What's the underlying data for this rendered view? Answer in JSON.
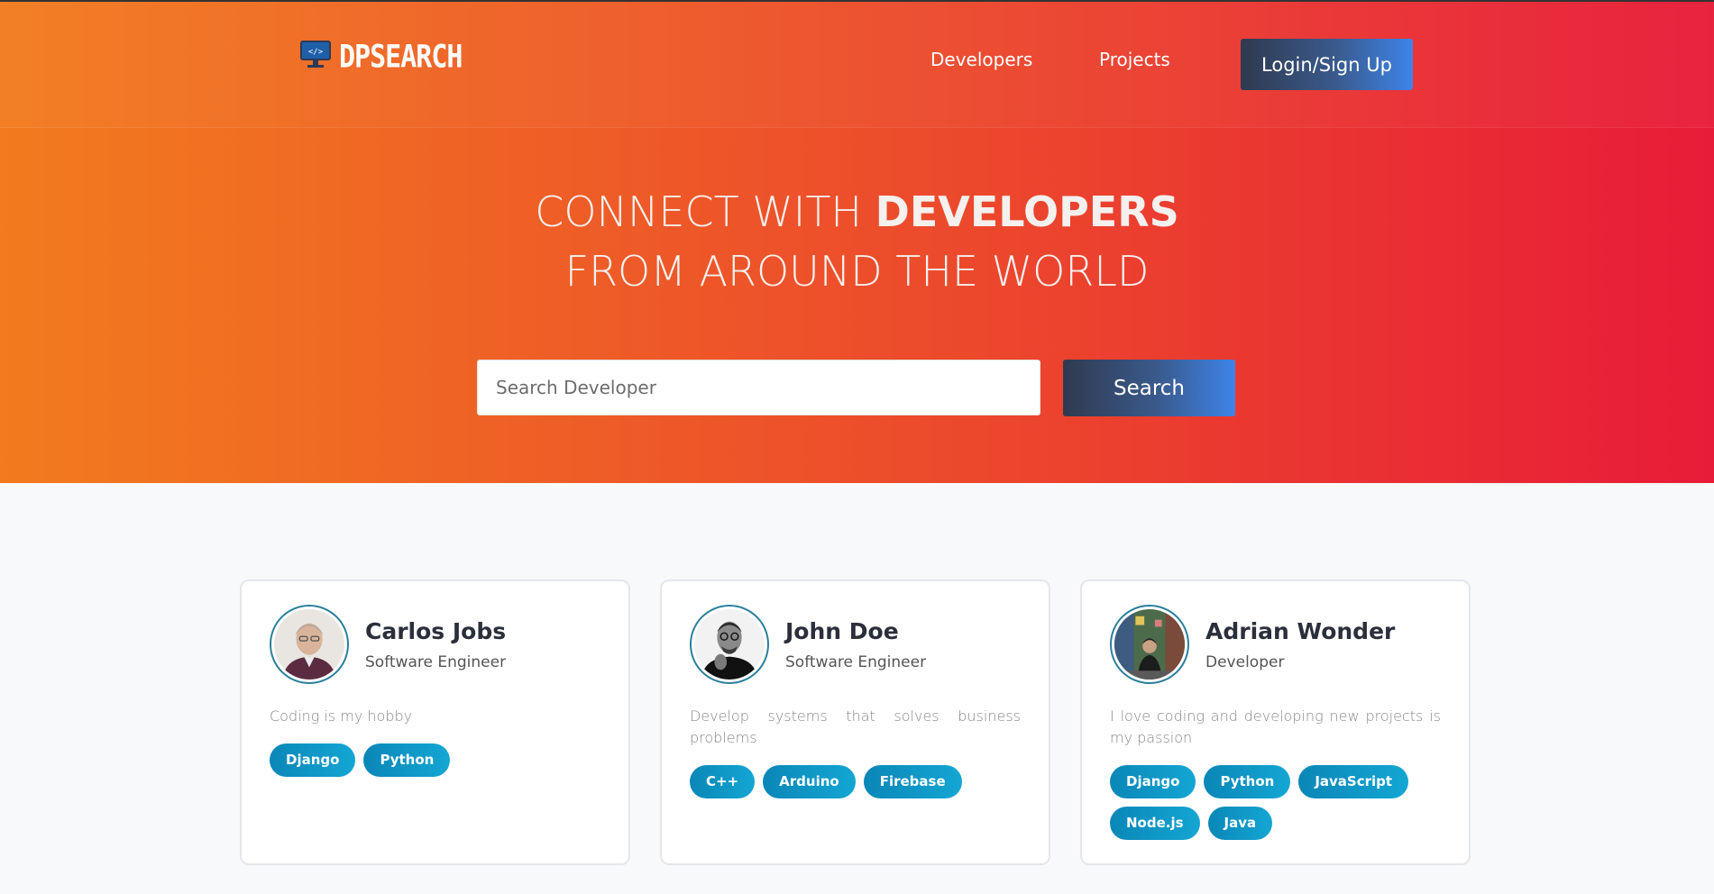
{
  "header": {
    "logo_text": "DPSEARCH",
    "nav": [
      {
        "label": "Developers"
      },
      {
        "label": "Projects"
      }
    ],
    "login_label": "Login/Sign Up"
  },
  "hero": {
    "line1_light": "CONNECT WITH",
    "line1_bold": "DEVELOPERS",
    "line2": "FROM AROUND THE WORLD",
    "search_placeholder": "Search Developer",
    "search_button": "Search"
  },
  "colors": {
    "hero_gradient_start": "#f27b1e",
    "hero_gradient_end": "#e81c38",
    "button_dark": "#2f3a4f",
    "button_blue": "#3e84e8",
    "tag_blue": "#0a87b7"
  },
  "developers": [
    {
      "name": "Carlos Jobs",
      "role": "Software Engineer",
      "bio": "Coding is my hobby",
      "avatar_icon": "avatar-photo-icon",
      "tags": [
        "Django",
        "Python"
      ]
    },
    {
      "name": "John Doe",
      "role": "Software Engineer",
      "bio": "Develop systems that solves business problems",
      "avatar_icon": "avatar-photo-icon",
      "tags": [
        "C++",
        "Arduino",
        "Firebase"
      ]
    },
    {
      "name": "Adrian Wonder",
      "role": "Developer",
      "bio": "I love coding and developing new projects is my passion",
      "avatar_icon": "avatar-photo-icon",
      "tags": [
        "Django",
        "Python",
        "JavaScript",
        "Node.js",
        "Java"
      ]
    }
  ]
}
